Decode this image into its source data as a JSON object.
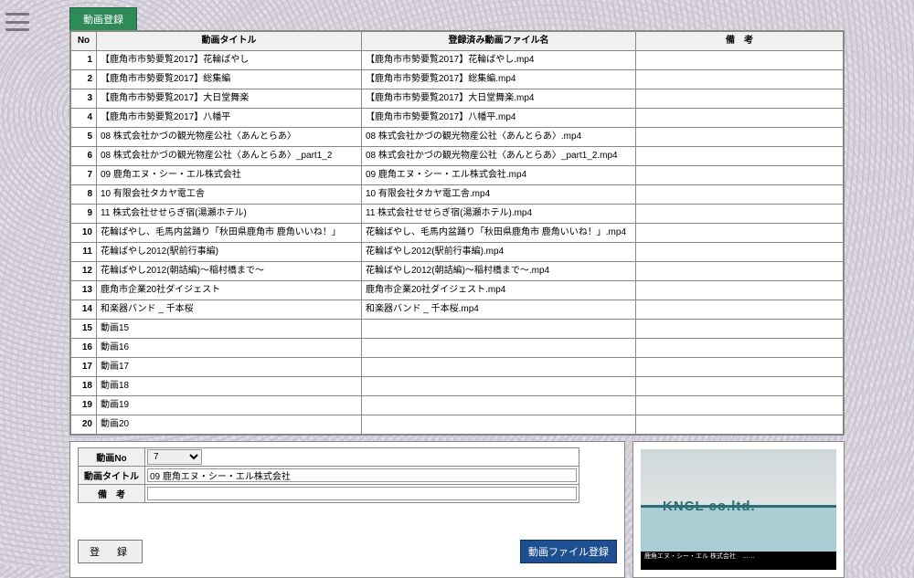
{
  "tab_label": "動画登録",
  "table": {
    "headers": {
      "no": "No",
      "title": "動画タイトル",
      "file": "登録済み動画ファイル名",
      "note": "備　考"
    },
    "rows": [
      {
        "no": "1",
        "title": "【鹿角市市勢要覧2017】花輪ばやし",
        "file": "【鹿角市市勢要覧2017】花輪ばやし.mp4",
        "note": ""
      },
      {
        "no": "2",
        "title": "【鹿角市市勢要覧2017】総集編",
        "file": "【鹿角市市勢要覧2017】総集編.mp4",
        "note": ""
      },
      {
        "no": "3",
        "title": "【鹿角市市勢要覧2017】大日堂舞楽",
        "file": "【鹿角市市勢要覧2017】大日堂舞楽.mp4",
        "note": ""
      },
      {
        "no": "4",
        "title": "【鹿角市市勢要覧2017】八幡平",
        "file": "【鹿角市市勢要覧2017】八幡平.mp4",
        "note": ""
      },
      {
        "no": "5",
        "title": "08 株式会社かづの観光物産公社〈あんとらあ〉",
        "file": "08 株式会社かづの観光物産公社〈あんとらあ〉.mp4",
        "note": ""
      },
      {
        "no": "6",
        "title": "08 株式会社かづの観光物産公社〈あんとらあ〉_part1_2",
        "file": "08 株式会社かづの観光物産公社〈あんとらあ〉_part1_2.mp4",
        "note": ""
      },
      {
        "no": "7",
        "title": "09 鹿角エヌ・シー・エル株式会社",
        "file": "09 鹿角エヌ・シー・エル株式会社.mp4",
        "note": ""
      },
      {
        "no": "8",
        "title": "10 有限会社タカヤ電工舎",
        "file": "10 有限会社タカヤ電工舎.mp4",
        "note": ""
      },
      {
        "no": "9",
        "title": "11 株式会社せせらぎ宿(湯瀬ホテル)",
        "file": "11 株式会社せせらぎ宿(湯瀬ホテル).mp4",
        "note": ""
      },
      {
        "no": "10",
        "title": "花輪ばやし、毛馬内盆踊り「秋田県鹿角市 鹿角いいね！」",
        "file": "花輪ばやし、毛馬内盆踊り「秋田県鹿角市 鹿角いいね！」.mp4",
        "note": ""
      },
      {
        "no": "11",
        "title": "花輪ばやし2012(駅前行事編)",
        "file": "花輪ばやし2012(駅前行事編).mp4",
        "note": ""
      },
      {
        "no": "12",
        "title": "花輪ばやし2012(朝詰編)～稲村橋まで～",
        "file": "花輪ばやし2012(朝詰編)～稲村橋まで～.mp4",
        "note": ""
      },
      {
        "no": "13",
        "title": "鹿角市企業20社ダイジェスト",
        "file": "鹿角市企業20社ダイジェスト.mp4",
        "note": ""
      },
      {
        "no": "14",
        "title": "和楽器バンド _ 千本桜",
        "file": "和楽器バンド _ 千本桜.mp4",
        "note": ""
      },
      {
        "no": "15",
        "title": "動画15",
        "file": "",
        "note": ""
      },
      {
        "no": "16",
        "title": "動画16",
        "file": "",
        "note": ""
      },
      {
        "no": "17",
        "title": "動画17",
        "file": "",
        "note": ""
      },
      {
        "no": "18",
        "title": "動画18",
        "file": "",
        "note": ""
      },
      {
        "no": "19",
        "title": "動画19",
        "file": "",
        "note": ""
      },
      {
        "no": "20",
        "title": "動画20",
        "file": "",
        "note": ""
      }
    ]
  },
  "form": {
    "labels": {
      "no": "動画No",
      "title": "動画タイトル",
      "note": "備　考"
    },
    "values": {
      "no": "7",
      "title": "09 鹿角エヌ・シー・エル株式会社",
      "note": ""
    }
  },
  "buttons": {
    "register": "登　録",
    "file_register": "動画ファイル登録"
  },
  "preview": {
    "sign": "KNCL co.ltd.",
    "caption": "鹿角エヌ・シー・エル 株式会社　……"
  }
}
